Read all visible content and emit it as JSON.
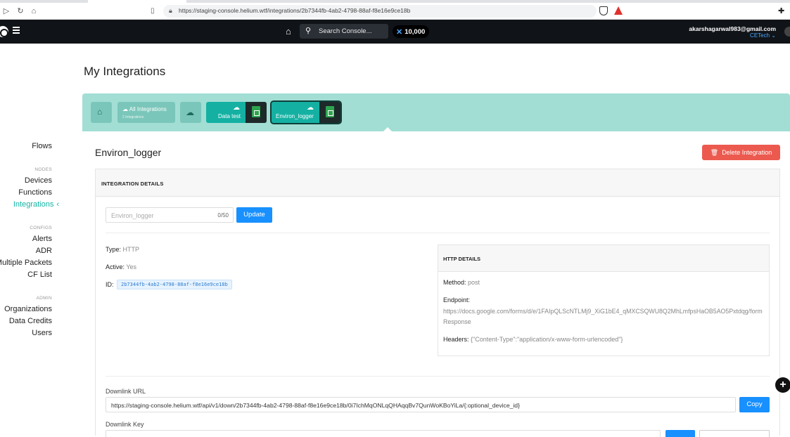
{
  "browser": {
    "url": "https://staging-console.helium.wtf/integrations/2b7344fb-4ab2-4798-88af-f8e16e9ce18b"
  },
  "topbar": {
    "search_placeholder": "Search Console...",
    "credits": "10,000",
    "user_email": "akarshagarwal983@gmail.com",
    "org": "CETech"
  },
  "sidebar": {
    "flows": "Flows",
    "nodes_section": "NODES",
    "devices": "Devices",
    "functions": "Functions",
    "integrations": "Integrations",
    "configs_section": "CONFIGS",
    "alerts": "Alerts",
    "adr": "ADR",
    "multiple_packets": "Multiple Packets",
    "cf_list": "CF List",
    "admin_section": "ADMIN",
    "organizations": "Organizations",
    "data_credits": "Data Credits",
    "users": "Users"
  },
  "page": {
    "title": "My Integrations"
  },
  "band": {
    "all_label": "All Integrations",
    "all_count": "2 Integrations",
    "integrations": [
      {
        "name": "Data test"
      },
      {
        "name": "Environ_logger"
      }
    ]
  },
  "integration": {
    "name": "Environ_logger",
    "delete_label": "Delete Integration",
    "details_header": "INTEGRATION DETAILS",
    "name_value": "Environ_logger",
    "char_count": "0/50",
    "update_label": "Update",
    "type_label": "Type:",
    "type_value": "HTTP",
    "active_label": "Active:",
    "active_value": "Yes",
    "id_label": "ID:",
    "id_value": "2b7344fb-4ab2-4798-88af-f8e16e9ce18b"
  },
  "http": {
    "header": "HTTP DETAILS",
    "method_label": "Method:",
    "method_value": "post",
    "endpoint_label": "Endpoint:",
    "endpoint_value": "https://docs.google.com/forms/d/e/1FAIpQLScNTLMj9_XiG1bE4_qMXCSQWU8Q2MhLmfpsHaOB5AO5Pxtdqg/formResponse",
    "headers_label": "Headers:",
    "headers_value": "{\"Content-Type\":\"application/x-www-form-urlencoded\"}"
  },
  "downlink": {
    "url_label": "Downlink URL",
    "url_value": "https://staging-console.helium.wtf/api/v1/down/2b7344fb-4ab2-4798-88af-f8e16e9ce18b/0i7IchMqONLqQHAqqBv7QunWoKBoYiLa/{:optional_device_id}",
    "copy_label": "Copy",
    "key_label": "Downlink Key"
  },
  "colors": {
    "accent": "#13b5a6",
    "band": "#a2ded4",
    "primary": "#1890ff",
    "danger": "#ec5a4f"
  }
}
